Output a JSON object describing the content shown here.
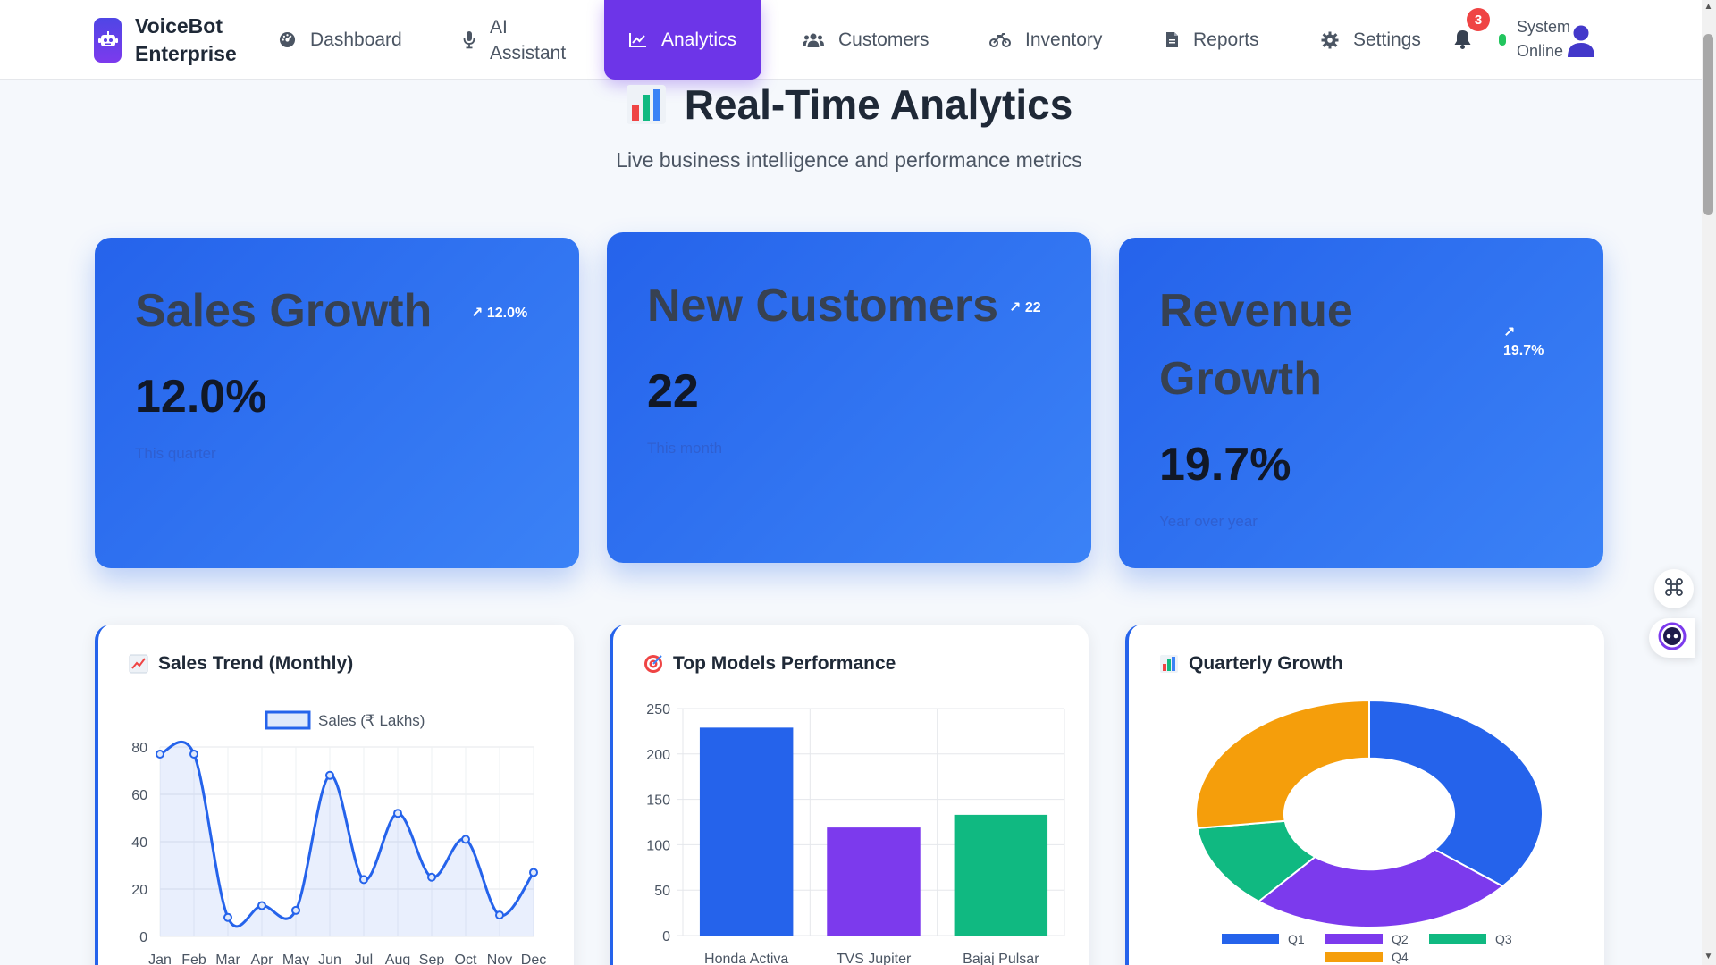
{
  "brand": {
    "name": "VoiceBot Enterprise"
  },
  "nav": {
    "items": [
      {
        "label": "Dashboard",
        "icon": "dashboard-icon"
      },
      {
        "label": "AI Assistant",
        "icon": "microphone-icon"
      },
      {
        "label": "Analytics",
        "icon": "chart-line-icon",
        "active": true
      },
      {
        "label": "Customers",
        "icon": "users-icon"
      },
      {
        "label": "Inventory",
        "icon": "motorcycle-icon"
      },
      {
        "label": "Reports",
        "icon": "file-icon"
      },
      {
        "label": "Settings",
        "icon": "gear-icon"
      }
    ],
    "notifications_count": "3",
    "status_text": "System Online"
  },
  "header": {
    "title": "Real-Time Analytics",
    "subtitle": "Live business intelligence and performance metrics"
  },
  "kpis": [
    {
      "title": "Sales Growth",
      "trend": "↗ 12.0%",
      "value": "12.0%",
      "sub": "This quarter"
    },
    {
      "title": "New Customers",
      "trend": "↗ 22",
      "value": "22",
      "sub": "This month"
    },
    {
      "title": "Revenue Growth",
      "trend_arrow": "↗",
      "trend_value": "19.7%",
      "value": "19.7%",
      "sub": "Year over year"
    }
  ],
  "charts": {
    "sales_trend_title": "Sales Trend (Monthly)",
    "top_models_title": "Top Models Performance",
    "quarterly_title": "Quarterly Growth"
  },
  "colors": {
    "primary": "#2563eb",
    "accent_purple": "#6d35e8",
    "green": "#10b981",
    "orange": "#f59e0b",
    "danger": "#ef4444"
  },
  "chart_data": [
    {
      "type": "line",
      "title": "Sales Trend (Monthly)",
      "series": [
        {
          "name": "Sales (₹ Lakhs)",
          "values": [
            77,
            77,
            8,
            13,
            11,
            68,
            24,
            52,
            25,
            41,
            9,
            27
          ]
        }
      ],
      "categories": [
        "Jan",
        "Feb",
        "Mar",
        "Apr",
        "May",
        "Jun",
        "Jul",
        "Aug",
        "Sep",
        "Oct",
        "Nov",
        "Dec"
      ],
      "ylim": [
        0,
        80
      ],
      "yticks": [
        0,
        20,
        40,
        60,
        80
      ],
      "grid": true,
      "legend": "top"
    },
    {
      "type": "bar",
      "title": "Top Models Performance",
      "categories": [
        "Honda Activa",
        "TVS Jupiter",
        "Bajaj Pulsar"
      ],
      "values": [
        228,
        118,
        132
      ],
      "colors": [
        "#2563eb",
        "#7c3aed",
        "#10b981"
      ],
      "ylim": [
        0,
        250
      ],
      "yticks": [
        0,
        50,
        100,
        150,
        200,
        250
      ],
      "grid": true
    },
    {
      "type": "pie",
      "title": "Quarterly Growth",
      "categories": [
        "Q1",
        "Q2",
        "Q3",
        "Q4"
      ],
      "values": [
        36,
        25,
        12,
        27
      ],
      "colors": [
        "#2563eb",
        "#7c3aed",
        "#10b981",
        "#f59e0b"
      ],
      "donut": true,
      "legend": "bottom"
    }
  ]
}
